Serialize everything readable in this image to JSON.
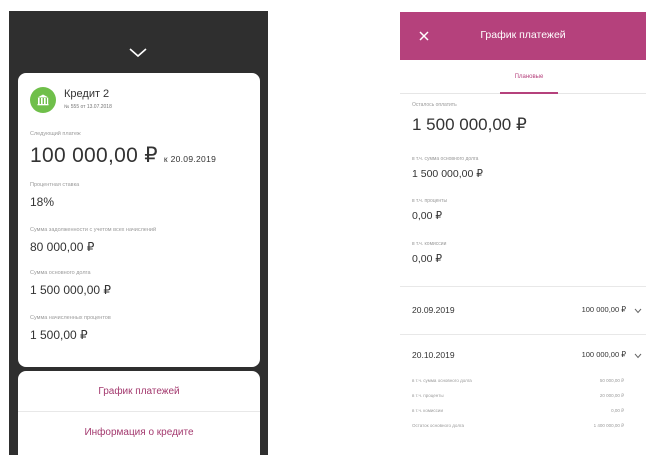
{
  "left": {
    "credit": {
      "name": "Кредит 2",
      "subtitle": "№ 555 от 13.07.2018"
    },
    "next_payment": {
      "label": "Следующий платеж",
      "amount": "100 000,00 ₽",
      "date": "к 20.09.2019"
    },
    "rate": {
      "label": "Процентная ставка",
      "value": "18%"
    },
    "debt_total": {
      "label": "Сумма задолженности с учетом всех начислений",
      "value": "80 000,00 ₽"
    },
    "principal": {
      "label": "Сумма основного долга",
      "value": "1 500 000,00 ₽"
    },
    "accrued_interest": {
      "label": "Сумма начисленных процентов",
      "value": "1 500,00 ₽"
    },
    "actions": {
      "schedule": "График платежей",
      "info": "Информация о кредите"
    }
  },
  "right": {
    "header": {
      "title": "График платежей"
    },
    "tab": {
      "label": "Плановые"
    },
    "remaining": {
      "label": "Осталось оплатить",
      "value": "1 500 000,00 ₽"
    },
    "principal": {
      "label": "в т.ч. сумма основного долга",
      "value": "1 500 000,00 ₽"
    },
    "interest": {
      "label": "в т.ч. проценты",
      "value": "0,00 ₽"
    },
    "commission": {
      "label": "в т.ч. комиссии",
      "value": "0,00 ₽"
    },
    "payments": [
      {
        "date": "20.09.2019",
        "amount": "100 000,00 ₽"
      },
      {
        "date": "20.10.2019",
        "amount": "100 000,00 ₽"
      }
    ],
    "details": [
      {
        "label": "в т.ч. сумма основного долга",
        "value": "50 000,00 ₽"
      },
      {
        "label": "в т.ч. проценты",
        "value": "20 000,00 ₽"
      },
      {
        "label": "в т.ч. комиссии",
        "value": "0,00 ₽"
      },
      {
        "label": "Остаток основного долга",
        "value": "1 400 000,00 ₽"
      }
    ]
  },
  "colors": {
    "brand": "#b5417c",
    "avatar": "#6fbf4a",
    "dark_bg": "#2f2f2f"
  }
}
